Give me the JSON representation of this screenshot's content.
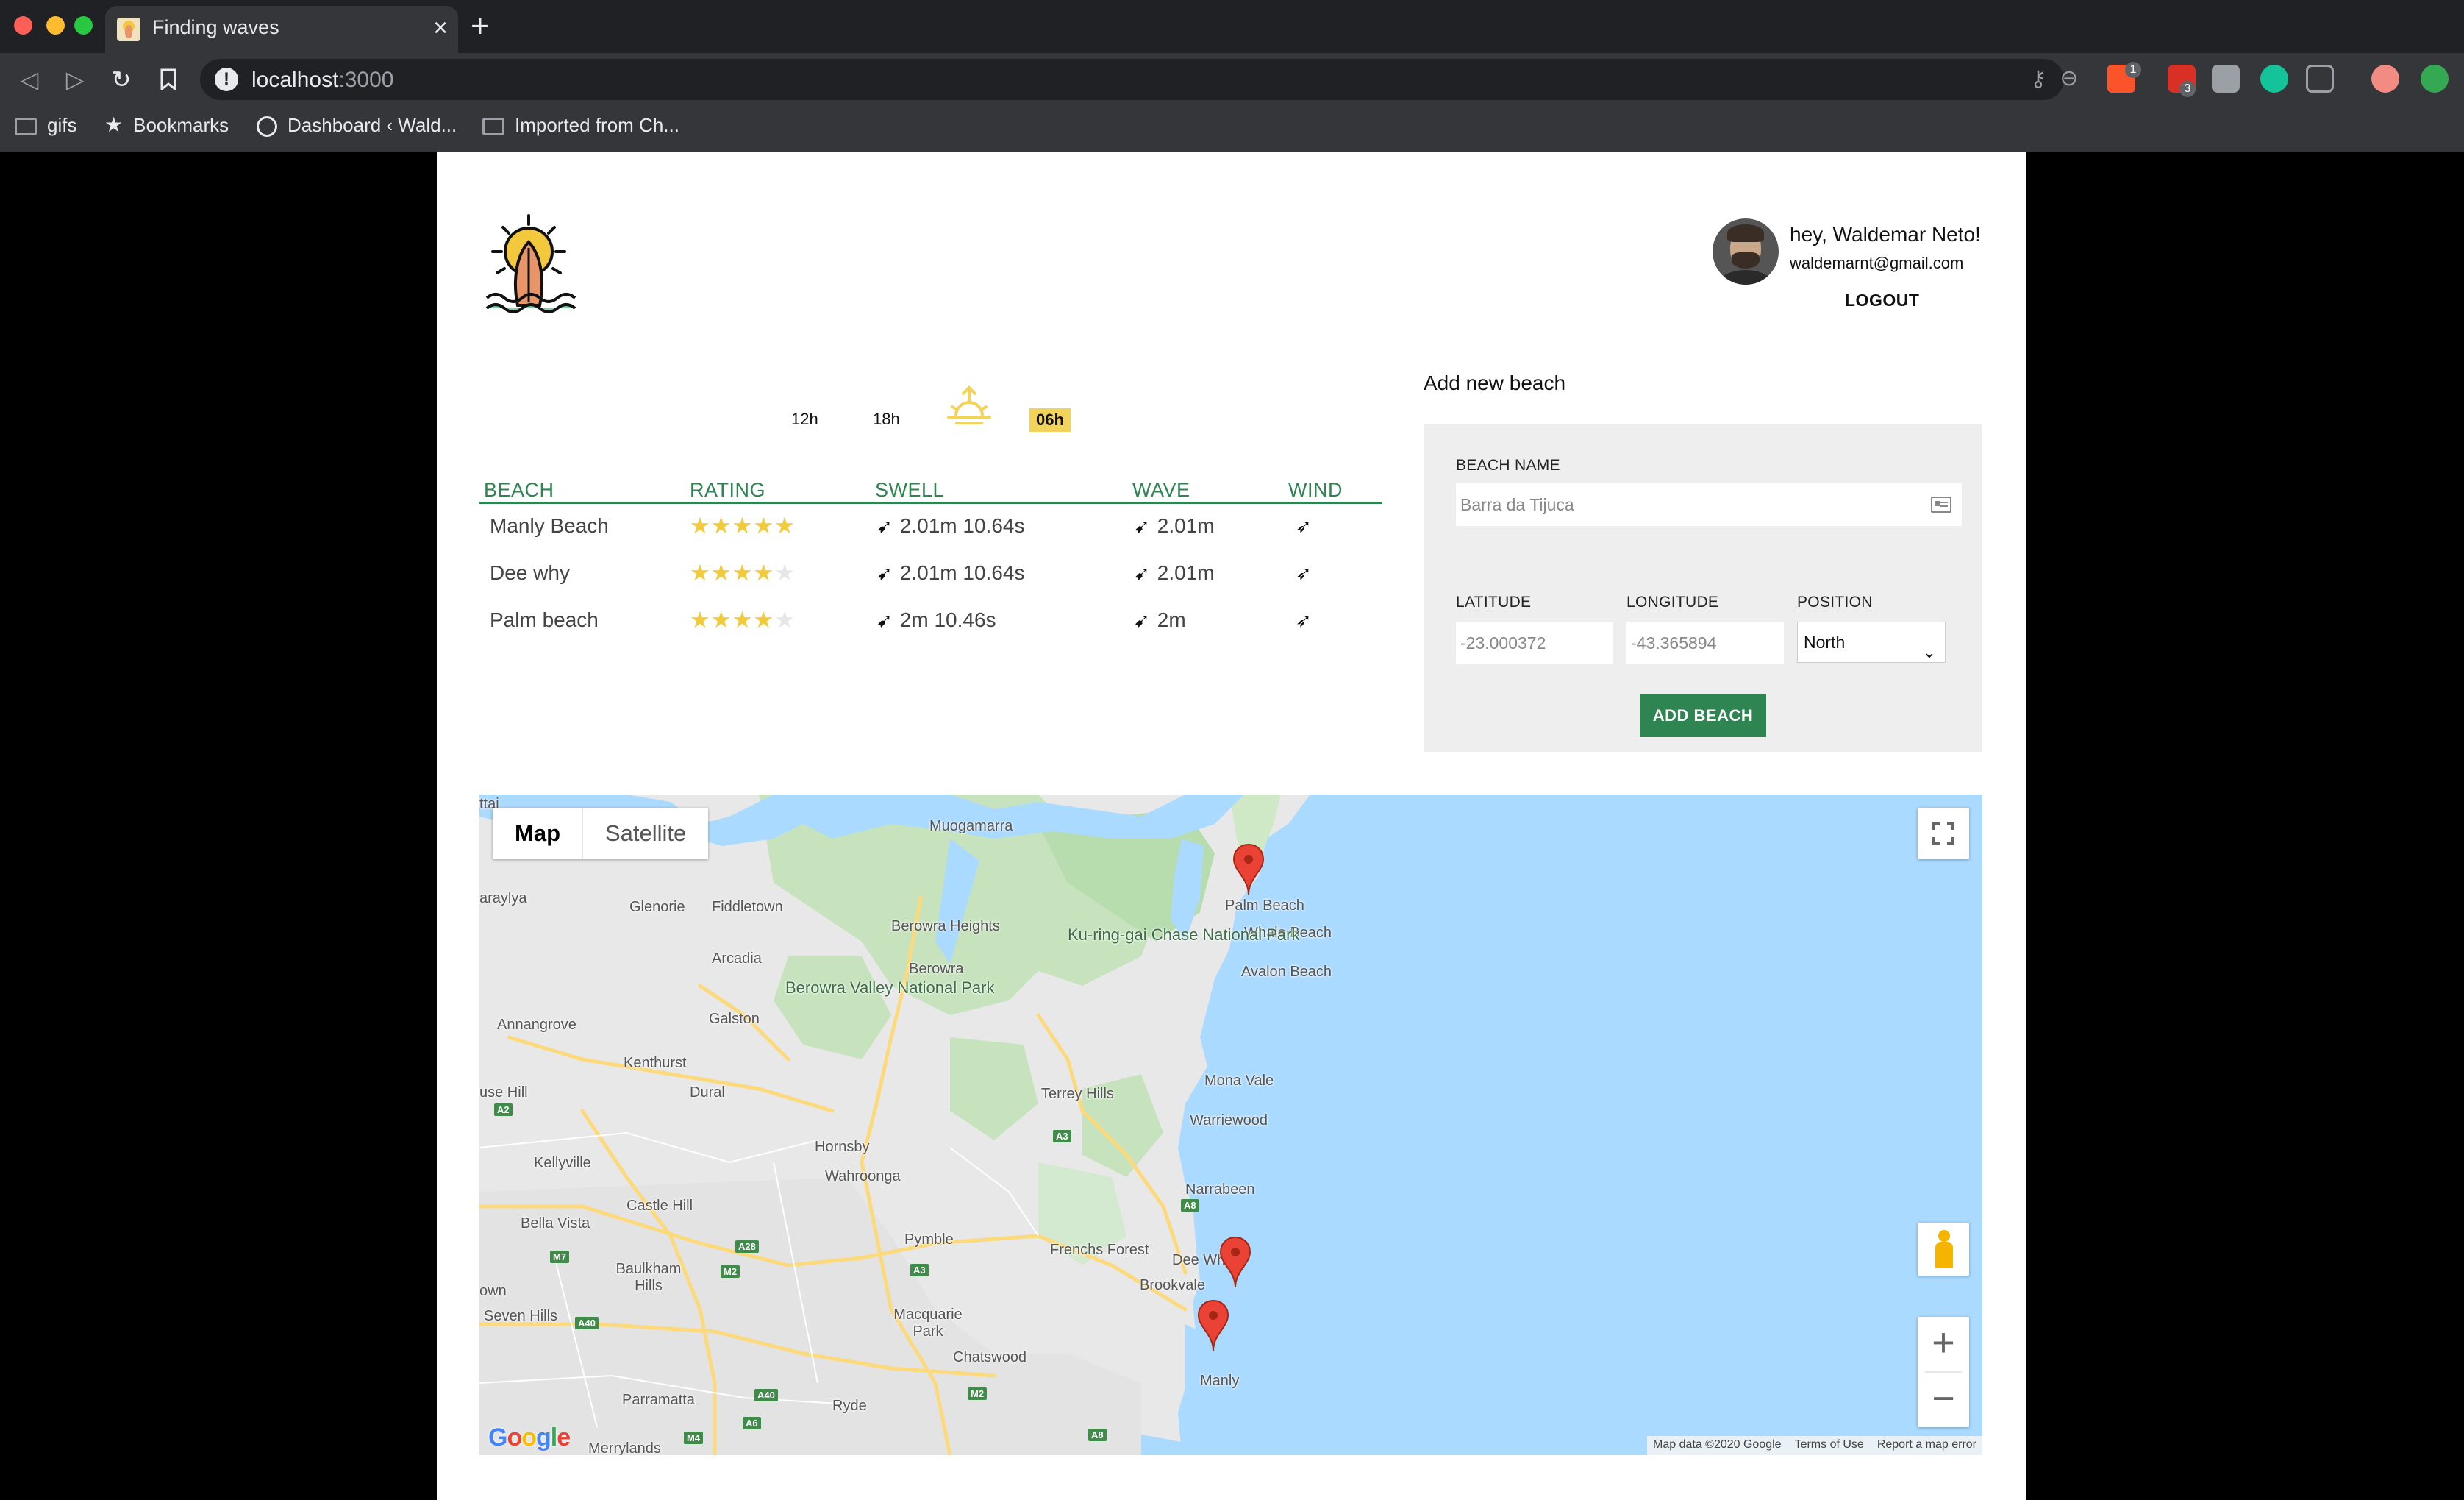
{
  "browser": {
    "tab_title": "Finding waves",
    "url_host": "localhost",
    "url_port": ":3000",
    "bookmarks": [
      "gifs",
      "Bookmarks",
      "Dashboard ‹ Wald...",
      "Imported from Ch..."
    ],
    "ext_badges": [
      "1",
      "3"
    ]
  },
  "user": {
    "greeting": "hey, Waldemar Neto!",
    "email": "waldemarnt@gmail.com",
    "logout_label": "LOGOUT"
  },
  "time_tabs": [
    "12h",
    "18h",
    "06h"
  ],
  "forecast": {
    "headers": [
      "BEACH",
      "RATING",
      "SWELL",
      "WAVE",
      "WIND"
    ],
    "rows": [
      {
        "beach": "Manly Beach",
        "rating": 5,
        "swell": "2.01m 10.64s",
        "wave": "2.01m"
      },
      {
        "beach": "Dee why",
        "rating": 4,
        "swell": "2.01m 10.64s",
        "wave": "2.01m"
      },
      {
        "beach": "Palm beach",
        "rating": 4,
        "swell": "2m 10.46s",
        "wave": "2m"
      }
    ]
  },
  "add_beach": {
    "title": "Add new beach",
    "name_label": "BEACH NAME",
    "name_placeholder": "Barra da Tijuca",
    "lat_label": "LATITUDE",
    "lat_placeholder": "-23.000372",
    "lng_label": "LONGITUDE",
    "lng_placeholder": "-43.365894",
    "position_label": "POSITION",
    "position_value": "North",
    "button_label": "ADD BEACH"
  },
  "map": {
    "type_map": "Map",
    "type_satellite": "Satellite",
    "places": [
      "Muogamarra",
      "Palm Beach",
      "Whale Beach",
      "Avalon Beach",
      "Glenorie",
      "Fiddletown",
      "Berowra Heights",
      "Berowra",
      "Ku-ring-gai Chase National Park",
      "Arcadia",
      "Berowra Valley National Park",
      "Annangrove",
      "Galston",
      "Kenthurst",
      "Dural",
      "Mona Vale",
      "Terrey Hills",
      "Warriewood",
      "Hornsby",
      "Wahroonga",
      "Kellyville",
      "Castle Hill",
      "Bella Vista",
      "Narrabeen",
      "Pymble",
      "Frenchs Forest",
      "Dee Wh",
      "Brookvale",
      "Baulkham Hills",
      "Seven Hills",
      "Macquarie Park",
      "Chatswood",
      "Manly",
      "Parramatta",
      "Ryde",
      "Merrylands",
      "ttai",
      "araylya",
      "use Hill",
      "own"
    ],
    "road_shields": [
      "A2",
      "M7",
      "A28",
      "M2",
      "A3",
      "A8",
      "A40",
      "M4",
      "A6"
    ],
    "attribution": [
      "Map data ©2020 Google",
      "Terms of Use",
      "Report a map error"
    ]
  },
  "colors": {
    "accent_green": "#2e8552",
    "star_yellow": "#f2cb3a",
    "active_time_bg": "#f2d45c",
    "water": "#aadaff"
  }
}
